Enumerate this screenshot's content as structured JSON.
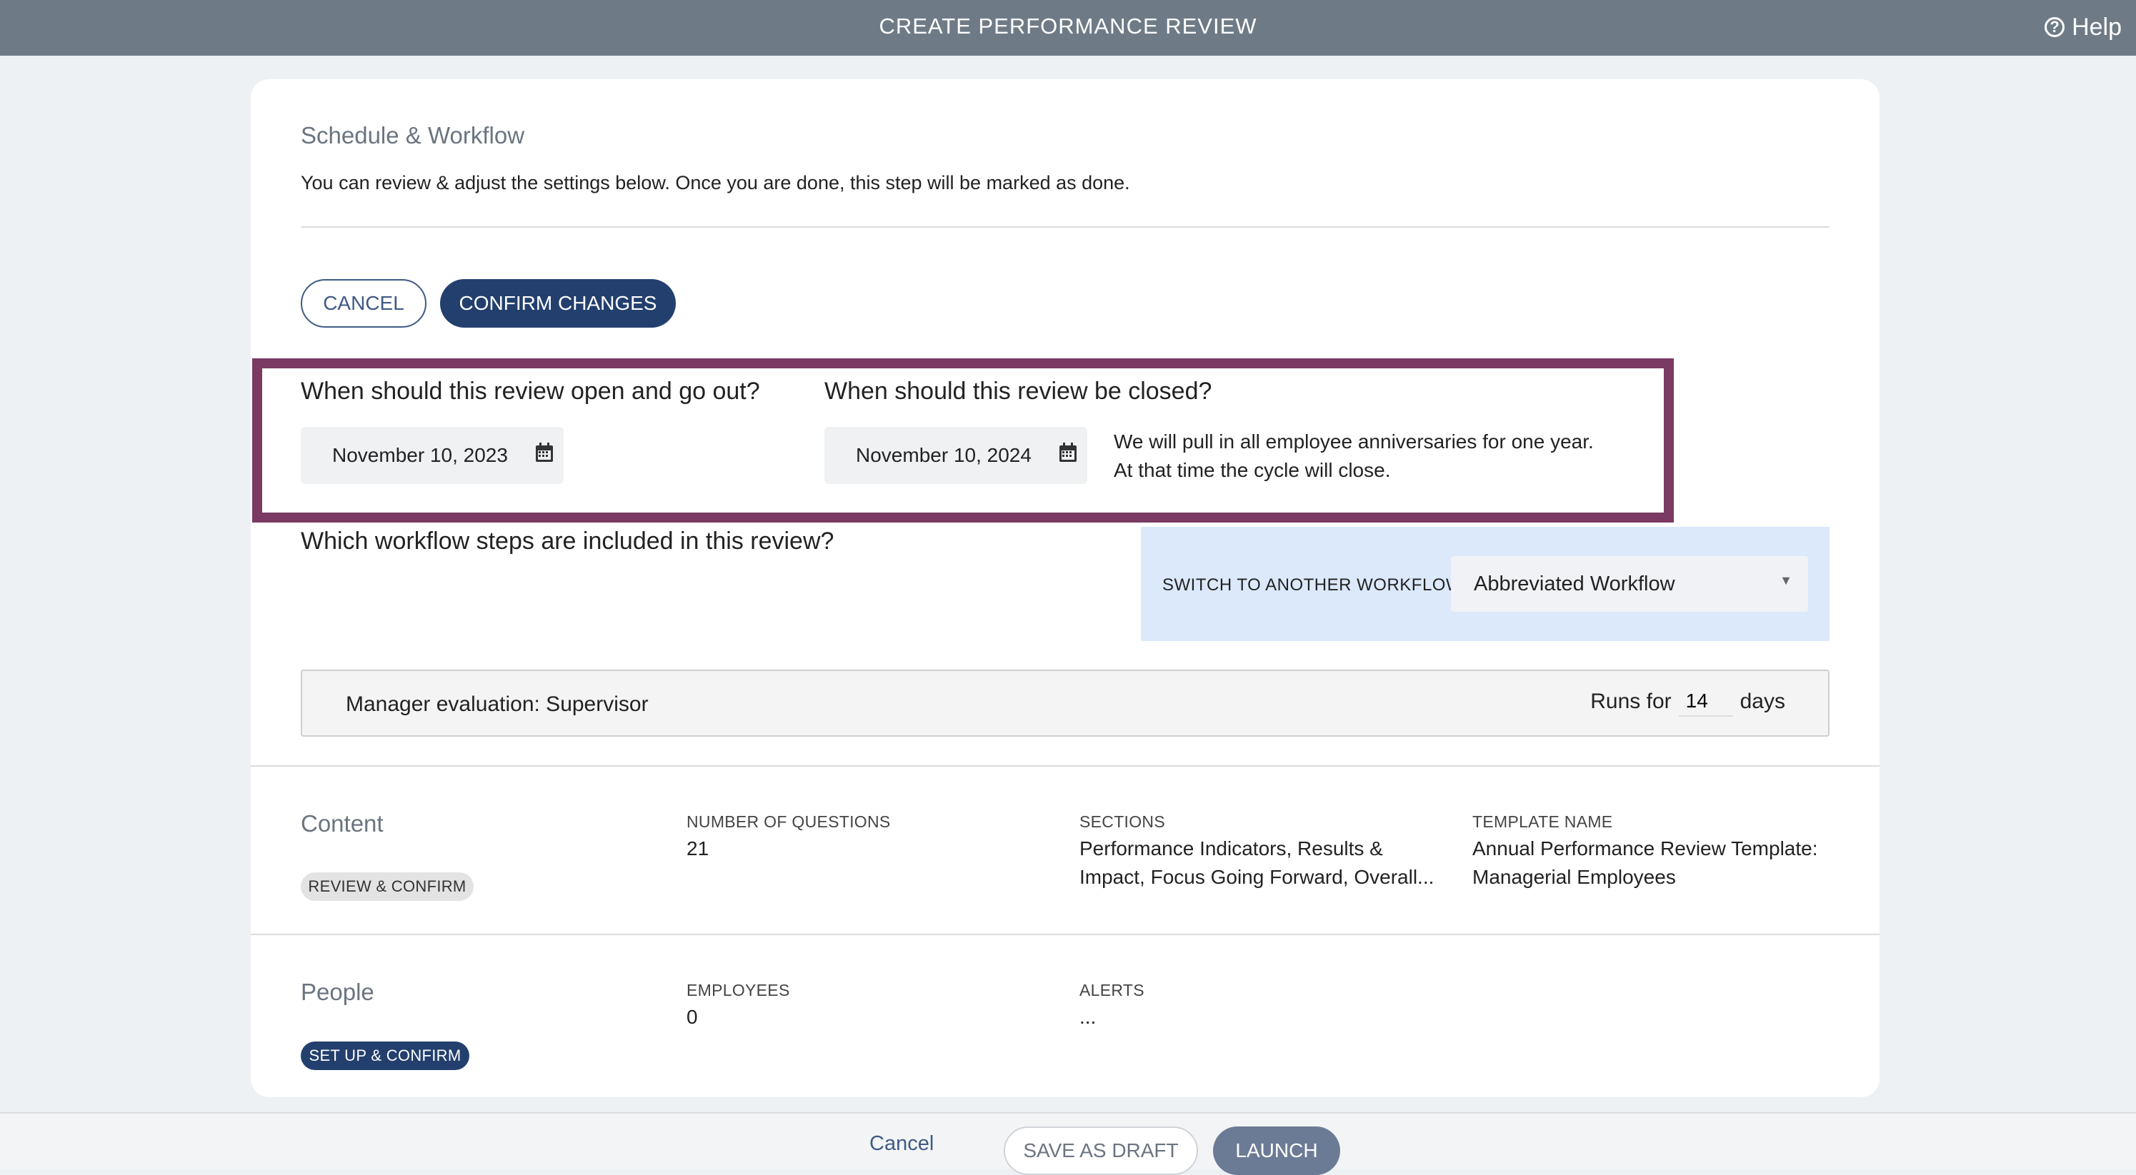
{
  "topbar": {
    "title": "CREATE PERFORMANCE REVIEW",
    "help_label": "Help"
  },
  "schedule": {
    "title": "Schedule & Workflow",
    "subtitle": "You can review & adjust the settings below. Once you are done, this step will be marked as done.",
    "cancel_label": "CANCEL",
    "confirm_label": "CONFIRM CHANGES",
    "open_question": "When should this review open and go out?",
    "open_date": "November 10, 2023",
    "close_question": "When should this review be closed?",
    "close_date": "November 10, 2024",
    "close_note_line1": "We will pull in all employee anniversaries for one year.",
    "close_note_line2": "At that time the cycle will close.",
    "workflow_question": "Which workflow steps are included in this review?",
    "switch_label": "SWITCH TO ANOTHER WORKFLOW",
    "workflow_selected": "Abbreviated Workflow",
    "step": {
      "label": "Manager evaluation: Supervisor",
      "runs_for_label": "Runs for",
      "days_value": "14",
      "days_label": "days"
    }
  },
  "content": {
    "title": "Content",
    "badge": "REVIEW & CONFIRM",
    "questions_label": "NUMBER OF QUESTIONS",
    "questions_value": "21",
    "sections_label": "SECTIONS",
    "sections_line1": "Performance Indicators, Results &",
    "sections_line2": "Impact, Focus Going Forward, Overall...",
    "template_label": "TEMPLATE NAME",
    "template_line1": "Annual Performance Review Template:",
    "template_line2": "Managerial Employees"
  },
  "people": {
    "title": "People",
    "badge": "SET UP & CONFIRM",
    "employees_label": "EMPLOYEES",
    "employees_value": "0",
    "alerts_label": "ALERTS",
    "alerts_value": "..."
  },
  "footer": {
    "cancel_label": "Cancel",
    "draft_label": "SAVE AS DRAFT",
    "launch_label": "LAUNCH"
  },
  "colors": {
    "topbar": "#6e7b87",
    "primary": "#233f6e",
    "highlight_border": "#7a3a63",
    "workflow_panel": "#dbe9fb"
  },
  "icons": [
    "help-circle-icon",
    "calendar-icon",
    "dropdown-arrow-icon"
  ]
}
